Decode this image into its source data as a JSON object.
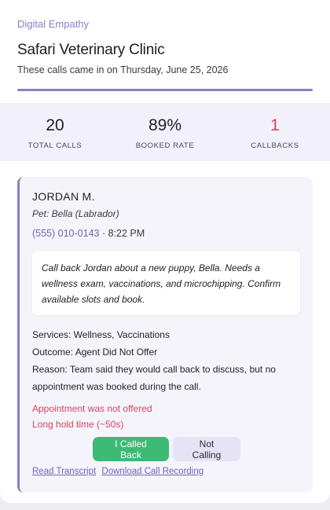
{
  "header": {
    "brand": "Digital Empathy",
    "clinic_name": "Safari Veterinary Clinic",
    "subtitle": "These calls came in on Thursday, June 25, 2026"
  },
  "stats": [
    {
      "value": "20",
      "label": "TOTAL CALLS"
    },
    {
      "value": "89%",
      "label": "BOOKED RATE"
    },
    {
      "value": "1",
      "label": "CALLBACKS"
    }
  ],
  "call": {
    "caller_name": "JORDAN M.",
    "pet": "Pet: Bella (Labrador)",
    "phone": "(555) 010-0143",
    "separator": " · ",
    "time": "8:22 PM",
    "note": "Call back Jordan about a new puppy, Bella. Needs a wellness exam, vaccinations, and microchipping. Confirm available slots and book.",
    "services": "Services: Wellness, Vaccinations",
    "outcome": "Outcome: Agent Did Not Offer",
    "reason": "Reason: Team said they would call back to discuss, but no appointment was booked during the call.",
    "flags": [
      "Appointment was not offered",
      "Long hold time (~50s)"
    ],
    "buttons": {
      "called_back": "I Called Back",
      "not_calling": "Not Calling"
    },
    "links": {
      "transcript": "Read Transcript",
      "recording": "Download Call Recording"
    }
  },
  "colors": {
    "accent": "#8b7fc4",
    "alert": "#d9435a",
    "success": "#3dba76"
  }
}
